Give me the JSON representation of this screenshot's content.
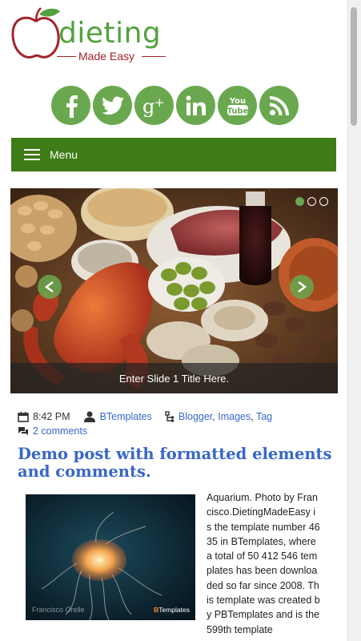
{
  "header": {
    "logo_word": "dieting",
    "logo_tagline": "Made Easy",
    "colors": {
      "green": "#53a23f",
      "red": "#a3242a"
    }
  },
  "social": [
    {
      "name": "facebook-icon",
      "glyph": "f"
    },
    {
      "name": "twitter-icon",
      "glyph": "twitter"
    },
    {
      "name": "google-plus-icon",
      "glyph": "g+"
    },
    {
      "name": "linkedin-icon",
      "glyph": "in"
    },
    {
      "name": "youtube-icon",
      "glyph": "You Tube"
    },
    {
      "name": "rss-icon",
      "glyph": "rss"
    }
  ],
  "menu": {
    "label": "Menu",
    "color": "#3e7c17"
  },
  "slider": {
    "caption": "Enter Slide 1 Title Here.",
    "active_dot": 1,
    "dot_count": 3
  },
  "post": {
    "time": "8:42 PM",
    "author": "BTemplates",
    "labels": [
      "Blogger",
      "Images",
      "Tag"
    ],
    "comments": "2 comments",
    "title": "Demo post with formatted elements and comments.",
    "image_credit": "Francisco Orelle",
    "image_brand_prefix": "B",
    "image_brand_rest": "Templates",
    "body": "Aquarium. Photo by Francisco.DietingMadeEasy is the template number 4635 in BTemplates, where a total of 50 412 546 templates has been downloaded so far since 2008. This template was created by PBTemplates and is the 599th template"
  }
}
